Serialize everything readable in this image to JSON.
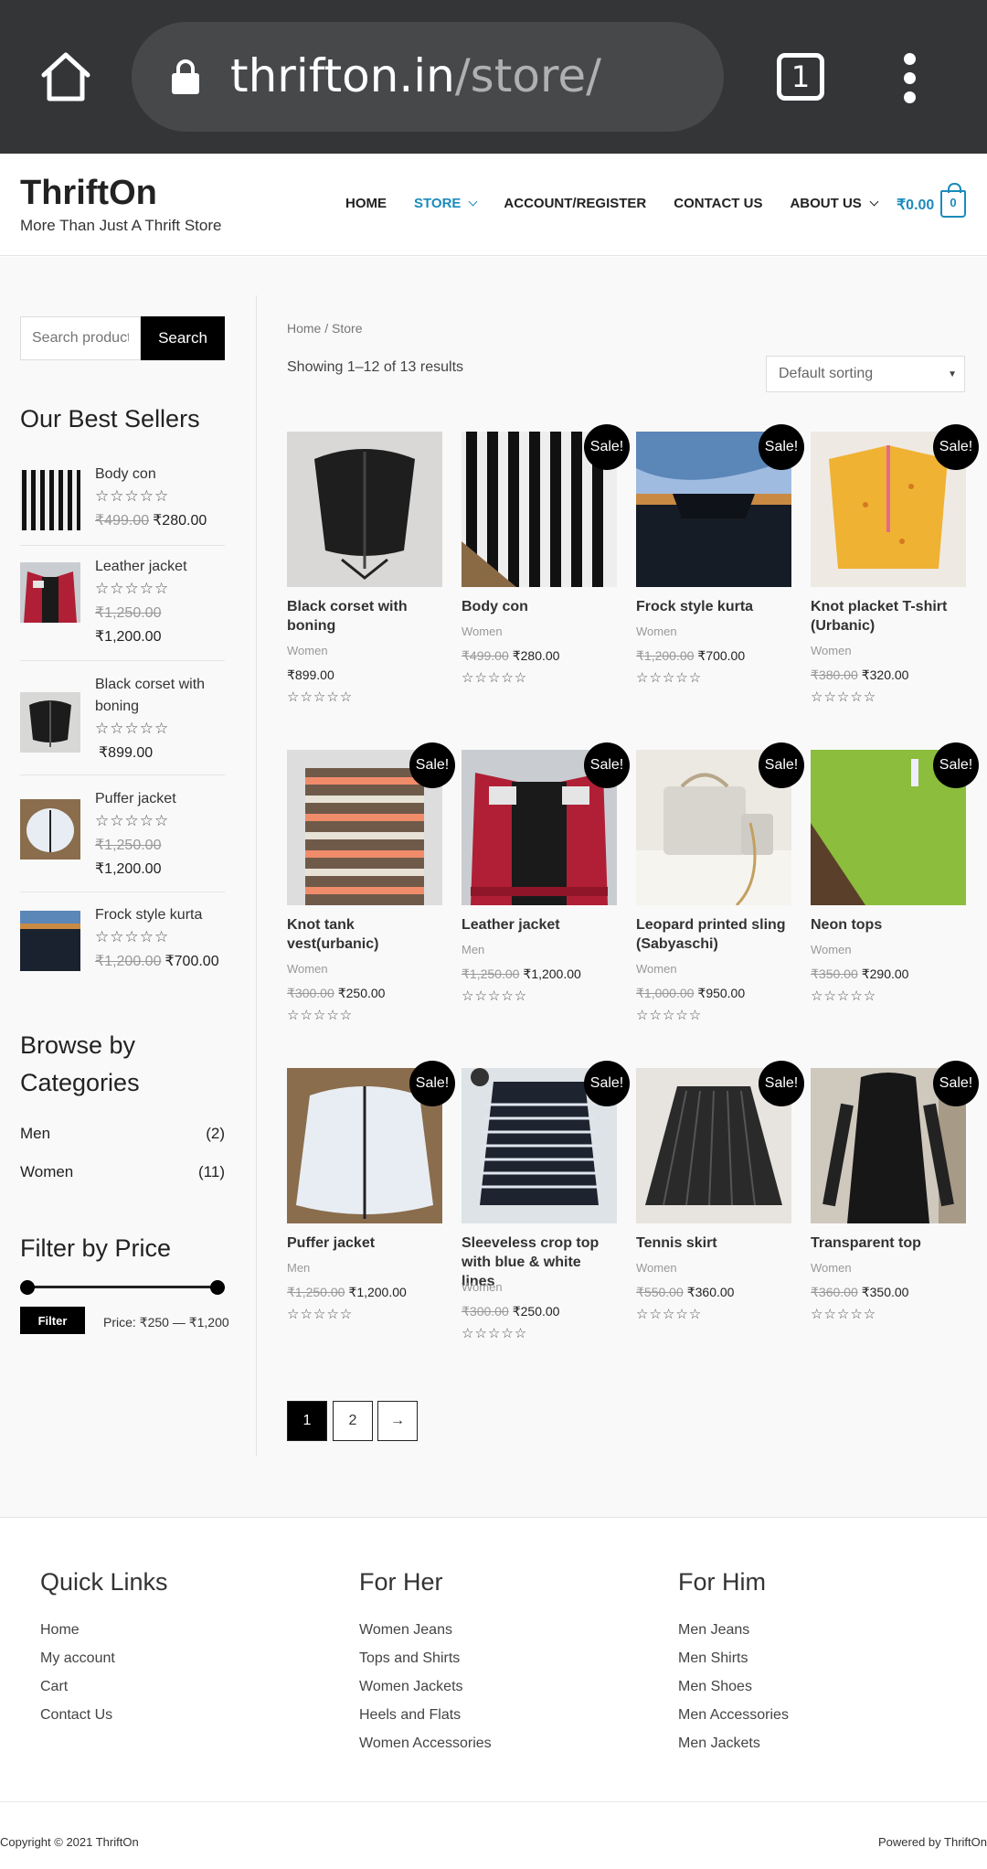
{
  "browser": {
    "url_host": "thrifton.in",
    "url_path": "/store/",
    "tab_count": "1",
    "icons": [
      "home-icon",
      "lock-icon",
      "tabs-icon",
      "menu-icon"
    ]
  },
  "site": {
    "title": "ThriftOn",
    "tagline": "More Than Just A Thrift Store",
    "accent_color": "#1b8bbd"
  },
  "nav": {
    "home": "HOME",
    "store": "STORE",
    "account": "ACCOUNT/REGISTER",
    "contact": "CONTACT US",
    "about": "ABOUT US",
    "cart_total": "₹0.00",
    "cart_count": "0"
  },
  "sidebar": {
    "search_placeholder": "Search products…",
    "search_button": "Search",
    "best_sellers_title": "Our Best Sellers",
    "best_sellers": [
      {
        "name": "Body con",
        "old_price": "₹499.00",
        "price": "₹280.00",
        "stars": "☆☆☆☆☆"
      },
      {
        "name": "Leather jacket",
        "old_price": "₹1,250.00",
        "price": "₹1,200.00",
        "stars": "☆☆☆☆☆"
      },
      {
        "name": "Black corset with boning",
        "old_price": "",
        "price": "₹899.00",
        "stars": "☆☆☆☆☆"
      },
      {
        "name": "Puffer jacket",
        "old_price": "₹1,250.00",
        "price": "₹1,200.00",
        "stars": "☆☆☆☆☆"
      },
      {
        "name": "Frock style kurta",
        "old_price": "₹1,200.00",
        "price": "₹700.00",
        "stars": "☆☆☆☆☆"
      }
    ],
    "categories_title": "Browse by Categories",
    "categories": [
      {
        "name": "Men",
        "count": "(2)"
      },
      {
        "name": "Women",
        "count": "(11)"
      }
    ],
    "price_filter_title": "Filter by Price",
    "filter_button": "Filter",
    "price_range": "Price: ₹250 — ₹1,200"
  },
  "shop": {
    "breadcrumb": "Home / Store",
    "result_count": "Showing 1–12 of 13 results",
    "sort_selected": "Default sorting",
    "sale_label": "Sale!",
    "products": [
      {
        "name": "Black corset with boning",
        "category": "Women",
        "old_price": "",
        "price": "₹899.00",
        "sale": false,
        "stars": "☆☆☆☆☆"
      },
      {
        "name": "Body con",
        "category": "Women",
        "old_price": "₹499.00",
        "price": "₹280.00",
        "sale": true,
        "stars": "☆☆☆☆☆"
      },
      {
        "name": "Frock style kurta",
        "category": "Women",
        "old_price": "₹1,200.00",
        "price": "₹700.00",
        "sale": true,
        "stars": "☆☆☆☆☆"
      },
      {
        "name": "Knot placket T-shirt (Urbanic)",
        "category": "Women",
        "old_price": "₹380.00",
        "price": "₹320.00",
        "sale": true,
        "stars": "☆☆☆☆☆"
      },
      {
        "name": "Knot tank vest(urbanic)",
        "category": "Women",
        "old_price": "₹300.00",
        "price": "₹250.00",
        "sale": true,
        "stars": "☆☆☆☆☆"
      },
      {
        "name": "Leather jacket",
        "category": "Men",
        "old_price": "₹1,250.00",
        "price": "₹1,200.00",
        "sale": true,
        "stars": "☆☆☆☆☆"
      },
      {
        "name": "Leopard printed sling (Sabyaschi)",
        "category": "Women",
        "old_price": "₹1,000.00",
        "price": "₹950.00",
        "sale": true,
        "stars": "☆☆☆☆☆"
      },
      {
        "name": "Neon tops",
        "category": "Women",
        "old_price": "₹350.00",
        "price": "₹290.00",
        "sale": true,
        "stars": "☆☆☆☆☆"
      },
      {
        "name": "Puffer jacket",
        "category": "Men",
        "old_price": "₹1,250.00",
        "price": "₹1,200.00",
        "sale": true,
        "stars": "☆☆☆☆☆"
      },
      {
        "name": "Sleeveless crop top with blue & white lines",
        "category": "Women",
        "old_price": "₹300.00",
        "price": "₹250.00",
        "sale": true,
        "stars": "☆☆☆☆☆"
      },
      {
        "name": "Tennis skirt",
        "category": "Women",
        "old_price": "₹550.00",
        "price": "₹360.00",
        "sale": true,
        "stars": "☆☆☆☆☆"
      },
      {
        "name": "Transparent top",
        "category": "Women",
        "old_price": "₹360.00",
        "price": "₹350.00",
        "sale": true,
        "stars": "☆☆☆☆☆"
      }
    ],
    "pagination": [
      "1",
      "2",
      "→"
    ]
  },
  "footer": {
    "quick_links_title": "Quick Links",
    "quick_links": [
      "Home",
      "My account",
      "Cart",
      "Contact Us"
    ],
    "for_her_title": "For Her",
    "for_her": [
      "Women Jeans",
      "Tops and Shirts",
      "Women Jackets",
      "Heels and Flats",
      "Women Accessories"
    ],
    "for_him_title": "For Him",
    "for_him": [
      "Men Jeans",
      "Men Shirts",
      "Men Shoes",
      "Men Accessories",
      "Men Jackets"
    ],
    "copyright": "Copyright © 2021 ThriftOn",
    "powered": "Powered by ThriftOn"
  }
}
